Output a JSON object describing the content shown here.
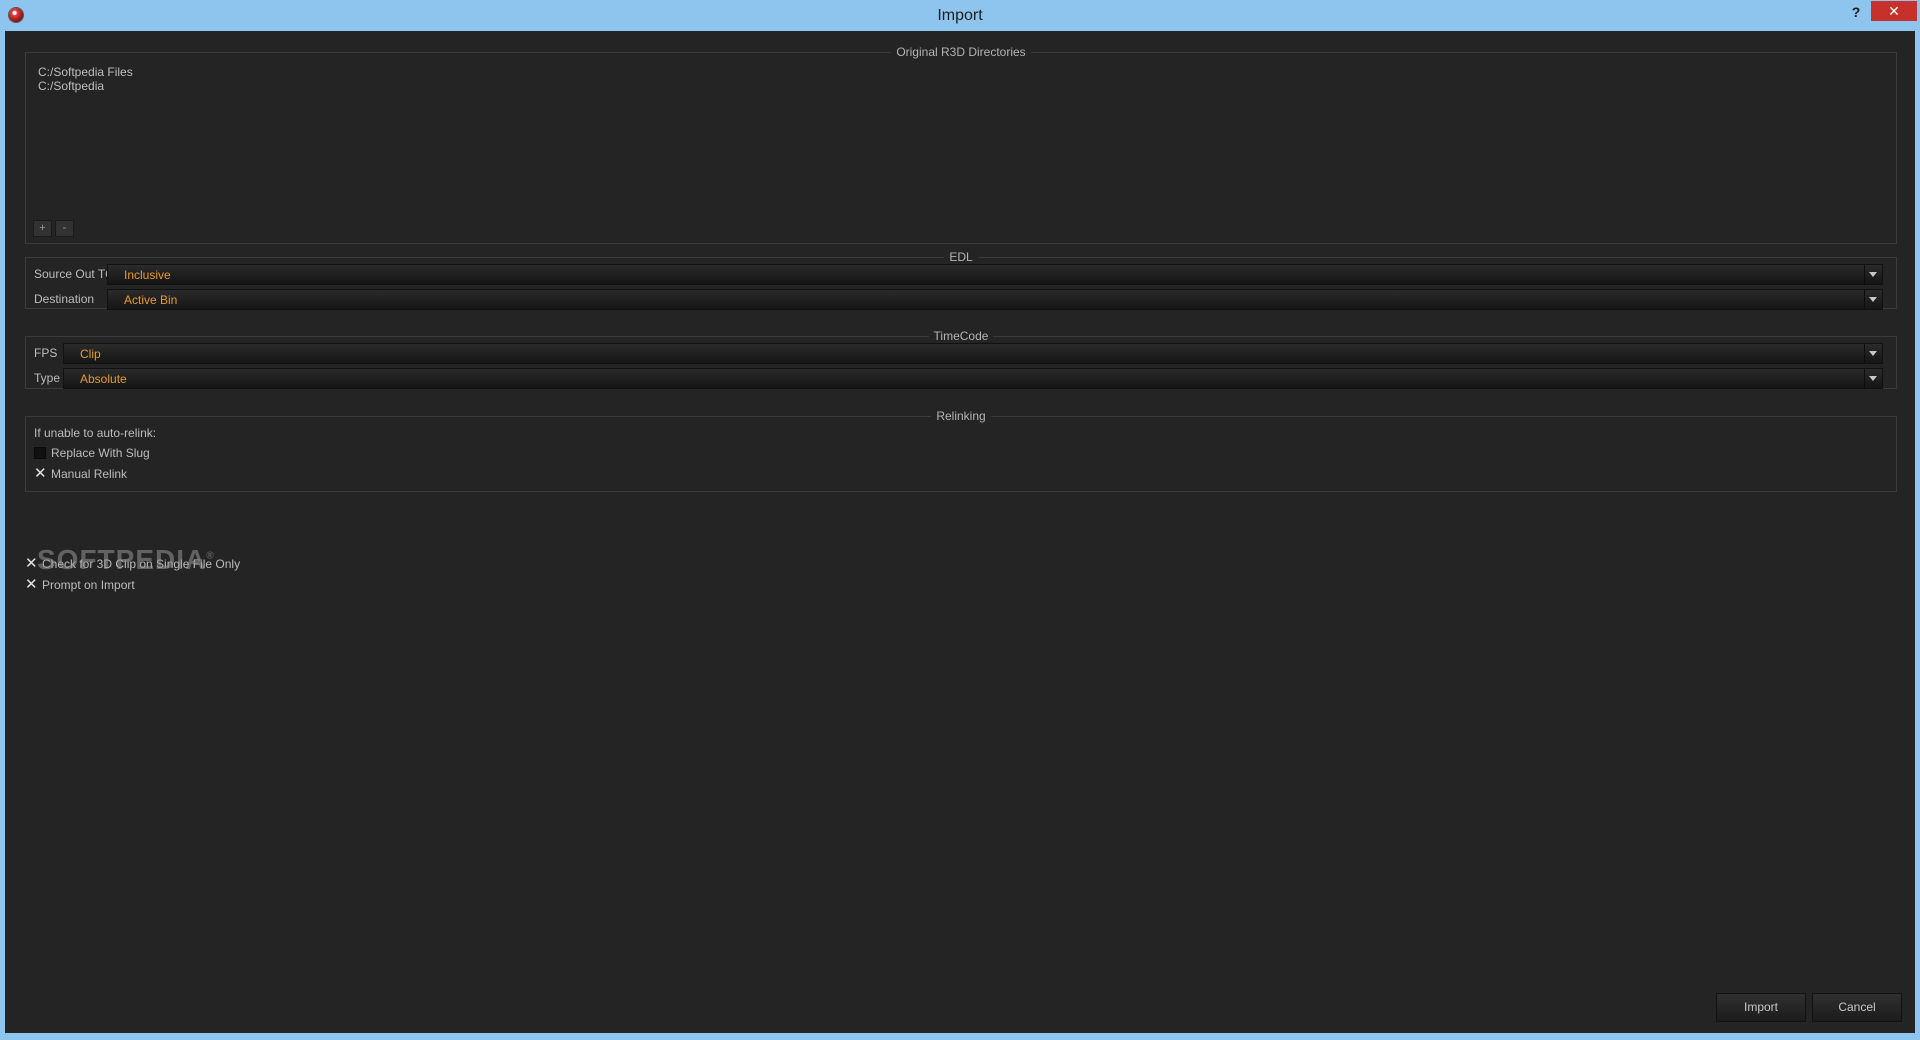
{
  "window": {
    "title": "Import",
    "help_label": "?",
    "close_label": "✕"
  },
  "directories": {
    "title": "Original R3D Directories",
    "items": [
      "C:/Softpedia Files",
      "C:/Softpedia"
    ],
    "add_label": "+",
    "remove_label": "-"
  },
  "edl": {
    "title": "EDL",
    "source_out_label": "Source Out TC",
    "source_out_value": "Inclusive",
    "destination_label": "Destination",
    "destination_value": "Active Bin"
  },
  "timecode": {
    "title": "TimeCode",
    "fps_label": "FPS",
    "fps_value": "Clip",
    "type_label": "Type",
    "type_value": "Absolute"
  },
  "relinking": {
    "title": "Relinking",
    "intro": "If unable to auto-relink:",
    "replace_slug_label": "Replace With Slug",
    "replace_slug_checked": false,
    "manual_relink_label": "Manual Relink",
    "manual_relink_checked": true
  },
  "options": {
    "check_3d_label": "Check for 3D Clip on Single File Only",
    "check_3d_checked": true,
    "prompt_import_label": "Prompt on Import",
    "prompt_import_checked": true
  },
  "watermark": "SOFTPEDIA",
  "buttons": {
    "import_label": "Import",
    "cancel_label": "Cancel"
  }
}
